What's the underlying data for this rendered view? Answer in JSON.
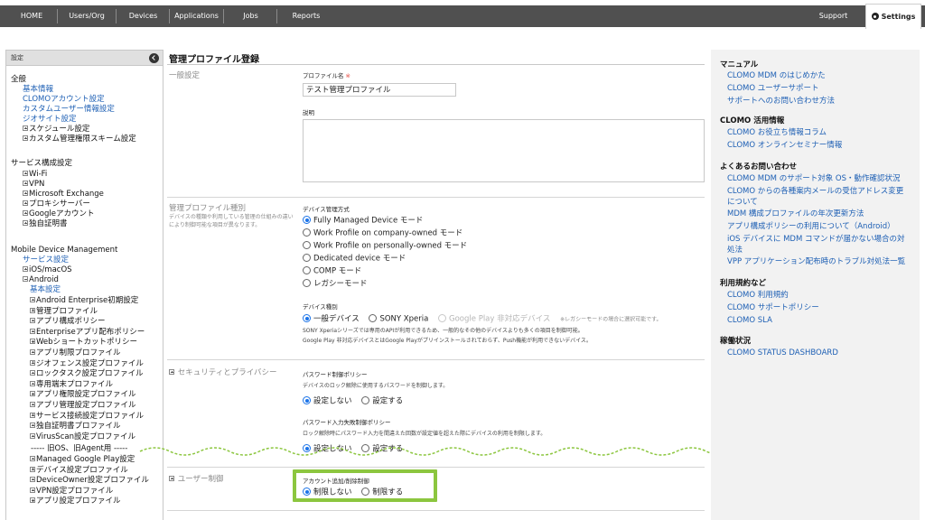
{
  "topnav": {
    "items": [
      "HOME",
      "Users/Org",
      "Devices",
      "Applications",
      "Jobs",
      "Reports"
    ],
    "support": "Support",
    "settings": "Settings"
  },
  "sidebar": {
    "header": "設定",
    "g1_title": "全般",
    "g1_links": [
      "基本情報",
      "CLOMOアカウント設定",
      "カスタムユーザー情報設定",
      "ジオサイト設定"
    ],
    "g1_tree": [
      "スケジュール設定",
      "カスタム管理権限スキーム設定"
    ],
    "g2_title": "サービス構成設定",
    "g2_tree": [
      "Wi-Fi",
      "VPN",
      "Microsoft Exchange",
      "プロキシサーバー",
      "Googleアカウント",
      "独自証明書"
    ],
    "g3_title": "Mobile Device Management",
    "g3_link": "サービス設定",
    "ios": "iOS/macOS",
    "android": "Android",
    "android_basic": "基本設定",
    "android_items": [
      "Android Enterprise初期設定",
      "管理プロファイル",
      "アプリ構成ポリシー",
      "Enterpriseアプリ配布ポリシー",
      "Webショートカットポリシー",
      "アプリ制限プロファイル",
      "ジオフェンス設定プロファイル",
      "ロックタスク設定プロファイル",
      "専用端末プロファイル",
      "アプリ権限設定プロファイル",
      "アプリ管理設定プロファイル",
      "サービス接続設定プロファイル",
      "独自証明書プロファイル",
      "VirusScan設定プロファイル"
    ],
    "legacy_divider": "----- 旧OS、旧Agent用 -----",
    "legacy_items": [
      "Managed Google Play設定",
      "デバイス設定プロファイル",
      "DeviceOwner設定プロファイル",
      "VPN設定プロファイル",
      "アプリ設定プロファイル"
    ]
  },
  "main": {
    "title": "管理プロファイル登録",
    "general": {
      "label": "一般設定",
      "name_label": "プロファイル名",
      "required_mark": "※",
      "name_value": "テスト管理プロファイル",
      "desc_label": "説明"
    },
    "type": {
      "label": "管理プロファイル種別",
      "desc": "デバイスの種類や利用している管理の仕組みの違いにより制御可能な項目が異なります。",
      "mgmt_label": "デバイス管理方式",
      "mgmt_options": [
        "Fully Managed Device モード",
        "Work Profile on company-owned モード",
        "Work Profile on personally-owned モード",
        "Dedicated device モード",
        "COMP モード",
        "レガシーモード"
      ],
      "device_type_label": "デバイス種別",
      "device_types": [
        "一般デバイス",
        "SONY Xperia",
        "Google Play 非対応デバイス"
      ],
      "device_type_note": "※レガシーモードの場合に選択可能です。",
      "help1": "SONY Xperiaシリーズでは専用のAPIが利用できるため、一般的なその他のデバイスよりも多くの項目を制御可能。",
      "help2": "Google Play 非対応デバイスとはGoogle Playがプリインストールされておらず、Push機能が利用できないデバイス。"
    },
    "security": {
      "label": "セキュリティとプライバシー",
      "pw_label": "パスワード制御ポリシー",
      "pw_help": "デバイスのロック解除に使用するパスワードを制御します。",
      "pw_options": [
        "設定しない",
        "設定する"
      ],
      "fail_label": "パスワード入力失敗制御ポリシー",
      "fail_help": "ロック解除時にパスワード入力を間違えた回数が設定値を超えた際にデバイスの利用を制限します。",
      "fail_options": [
        "設定しない",
        "設定する"
      ]
    },
    "user": {
      "label": "ユーザー制御",
      "acct_label": "アカウント追加/削除制御",
      "acct_options": [
        "制限しない",
        "制限する"
      ]
    }
  },
  "right": {
    "manual_title": "マニュアル",
    "manual_links": [
      "CLOMO MDM のはじめかた",
      "CLOMO ユーザーサポート",
      "サポートへのお問い合わせ方法"
    ],
    "use_title": "CLOMO 活用情報",
    "use_links": [
      "CLOMO お役立ち情報コラム",
      "CLOMO オンラインセミナー情報"
    ],
    "faq_title": "よくあるお問い合わせ",
    "faq_links": [
      "CLOMO MDM のサポート対象 OS・動作確認状況",
      "CLOMO からの各種案内メールの受信アドレス変更",
      "について",
      "MDM 構成プロファイルの年次更新方法",
      "アプリ構成ポリシーの利用について（Android）",
      "iOS デバイスに MDM コマンドが届かない場合の対",
      "処法",
      "VPP アプリケーション配布時のトラブル対処法一覧"
    ],
    "terms_title": "利用規約など",
    "terms_links": [
      "CLOMO 利用規約",
      "CLOMO サポートポリシー",
      "CLOMO SLA"
    ],
    "status_title": "稼働状況",
    "status_links": [
      "CLOMO STATUS DASHBOARD"
    ]
  },
  "colors": {
    "nav_bg": "#505050",
    "link": "#1d5fb4",
    "radio_selected": "#1a73e8",
    "highlight": "#8cc63f",
    "required": "#e4433a",
    "right_panel_bg": "#f2f2f2"
  },
  "icons": {
    "settings": "gear-icon",
    "sidebar_collapse": "chevron-left-circle-icon",
    "tree_collapsed": "plus-box-icon",
    "tree_expanded": "minus-box-icon"
  }
}
